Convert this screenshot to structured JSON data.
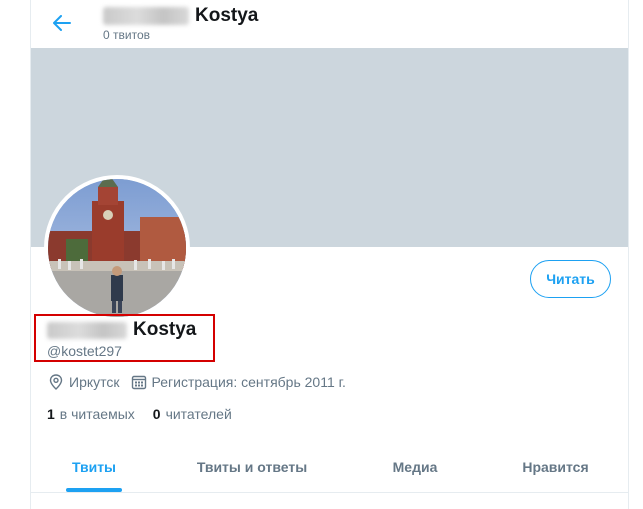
{
  "header": {
    "back_icon": "arrow-left-icon",
    "title": "Kostya",
    "tweet_count": "0 твитов"
  },
  "profile": {
    "name": "Kostya",
    "handle": "@kostet297",
    "location": "Иркутск",
    "joined": "Регистрация: сентябрь 2011 г.",
    "location_icon": "location-pin-icon",
    "calendar_icon": "calendar-icon",
    "following_count": "1",
    "following_label": "в читаемых",
    "followers_count": "0",
    "followers_label": "читателей"
  },
  "actions": {
    "follow_label": "Читать"
  },
  "tabs": [
    {
      "label": "Твиты",
      "active": true
    },
    {
      "label": "Твиты и ответы",
      "active": false
    },
    {
      "label": "Медиа",
      "active": false
    },
    {
      "label": "Нравится",
      "active": false
    }
  ],
  "colors": {
    "accent": "#1da1f2",
    "banner": "#ccd6dd",
    "highlight_box": "#d40000",
    "secondary_text": "#657786"
  }
}
